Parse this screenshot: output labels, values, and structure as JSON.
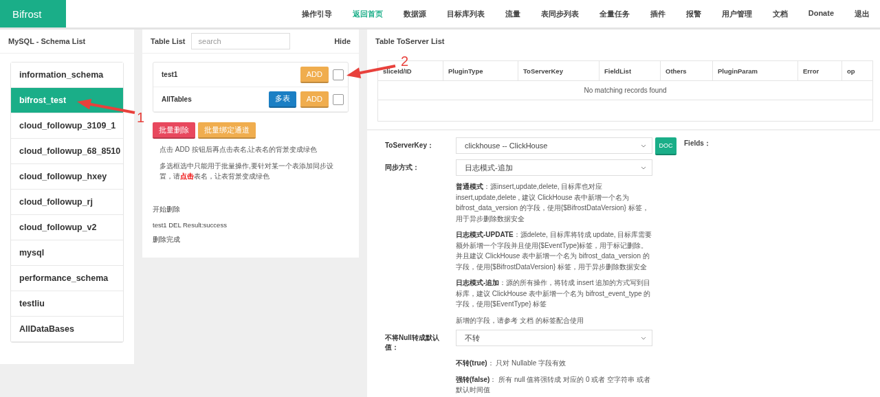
{
  "navbar": {
    "brand": "Bifrost",
    "items": [
      {
        "label": "操作引导",
        "selected": false
      },
      {
        "label": "返回首页",
        "selected": true
      },
      {
        "label": "数据源",
        "selected": false
      },
      {
        "label": "目标库列表",
        "selected": false
      },
      {
        "label": "流量",
        "selected": false
      },
      {
        "label": "表同步列表",
        "selected": false
      },
      {
        "label": "全量任务",
        "selected": false
      },
      {
        "label": "插件",
        "selected": false
      },
      {
        "label": "报警",
        "selected": false
      },
      {
        "label": "用户管理",
        "selected": false
      },
      {
        "label": "文档",
        "selected": false
      },
      {
        "label": "Donate",
        "selected": false
      },
      {
        "label": "退出",
        "selected": false
      }
    ]
  },
  "schema_list": {
    "title": "MySQL - Schema List",
    "items": [
      {
        "label": "information_schema",
        "selected": false
      },
      {
        "label": "bifrost_test",
        "selected": true
      },
      {
        "label": "cloud_followup_3109_1",
        "selected": false
      },
      {
        "label": "cloud_followup_68_8510",
        "selected": false
      },
      {
        "label": "cloud_followup_hxey",
        "selected": false
      },
      {
        "label": "cloud_followup_rj",
        "selected": false
      },
      {
        "label": "cloud_followup_v2",
        "selected": false
      },
      {
        "label": "mysql",
        "selected": false
      },
      {
        "label": "performance_schema",
        "selected": false
      },
      {
        "label": "testliu",
        "selected": false
      },
      {
        "label": "AllDataBases",
        "selected": false
      }
    ]
  },
  "table_list": {
    "title": "Table List",
    "search": {
      "placeholder": "search"
    },
    "hide": "Hide",
    "rows": [
      {
        "name": "test1",
        "checked": false,
        "buttons": [
          {
            "label": "ADD",
            "kind": "add"
          }
        ]
      },
      {
        "name": "AllTables",
        "checked": false,
        "buttons": [
          {
            "label": "多表",
            "kind": "multi"
          },
          {
            "label": "ADD",
            "kind": "add"
          }
        ]
      }
    ],
    "actions": [
      {
        "label": "批量删除",
        "kind": "danger"
      },
      {
        "label": "批量绑定通道",
        "kind": "warning"
      }
    ],
    "hints": [
      "点击 ADD 按钮后再点击表名,让表名的背景变成绿色",
      "多选框选中只能用于批量操作,要针对某一个表添加同步设置，请**点击**表名，让表背景变成绿色"
    ],
    "log": [
      "开始删除",
      "test1 DEL Result:success",
      "删除完成"
    ]
  },
  "toserver_list": {
    "title": "Table ToServer List",
    "columns": [
      "sliceId/ID",
      "PluginType",
      "ToServerKey",
      "FieldList",
      "Others",
      "PluginParam",
      "Error",
      "op"
    ],
    "empty": "No matching records found"
  },
  "form": {
    "fields": [
      {
        "label": "ToServerKey：",
        "value": "clickhouse -- ClickHouse",
        "doc_button": "DOC",
        "side_label": "Fields："
      },
      {
        "label": "同步方式：",
        "value": "日志模式-追加",
        "notes": [
          "**普通模式**：源insert,update,delete, 目标库也对应 insert,update,delete , 建议 ClickHouse 表中新增一个名为 bifrost_data_version 的字段，使用{$BifrostDataVersion} 标签，用于异步删除数据安全",
          "**日志模式-UPDATE**：源delete, 目标库将转成 update, 目标库需要额外新增一个字段并且使用{$EventType}标签，用于标记删除。并且建议 ClickHouse 表中新增一个名为 bifrost_data_version 的字段，使用{$BifrostDataVersion} 标签，用于异步删除数据安全",
          "**日志模式-追加**：源的所有操作，将转成 insert 追加的方式写到目标库，建议 ClickHouse 表中新增一个名为 bifrost_event_type 的字段，使用{$EventType} 标签",
          "新增的字段，请参考 文档 的标签配合使用"
        ]
      },
      {
        "label": "不将Null转成默认值：",
        "value": "不转",
        "notes": [
          "**不转(true)**： 只对 Nullable 字段有效",
          "**强转(false)**： 所有 null 值将强转成 对应的 0 或者 空字符串 或者默认时间值"
        ]
      }
    ]
  },
  "annotations": [
    {
      "label": "1"
    },
    {
      "label": "2"
    }
  ]
}
